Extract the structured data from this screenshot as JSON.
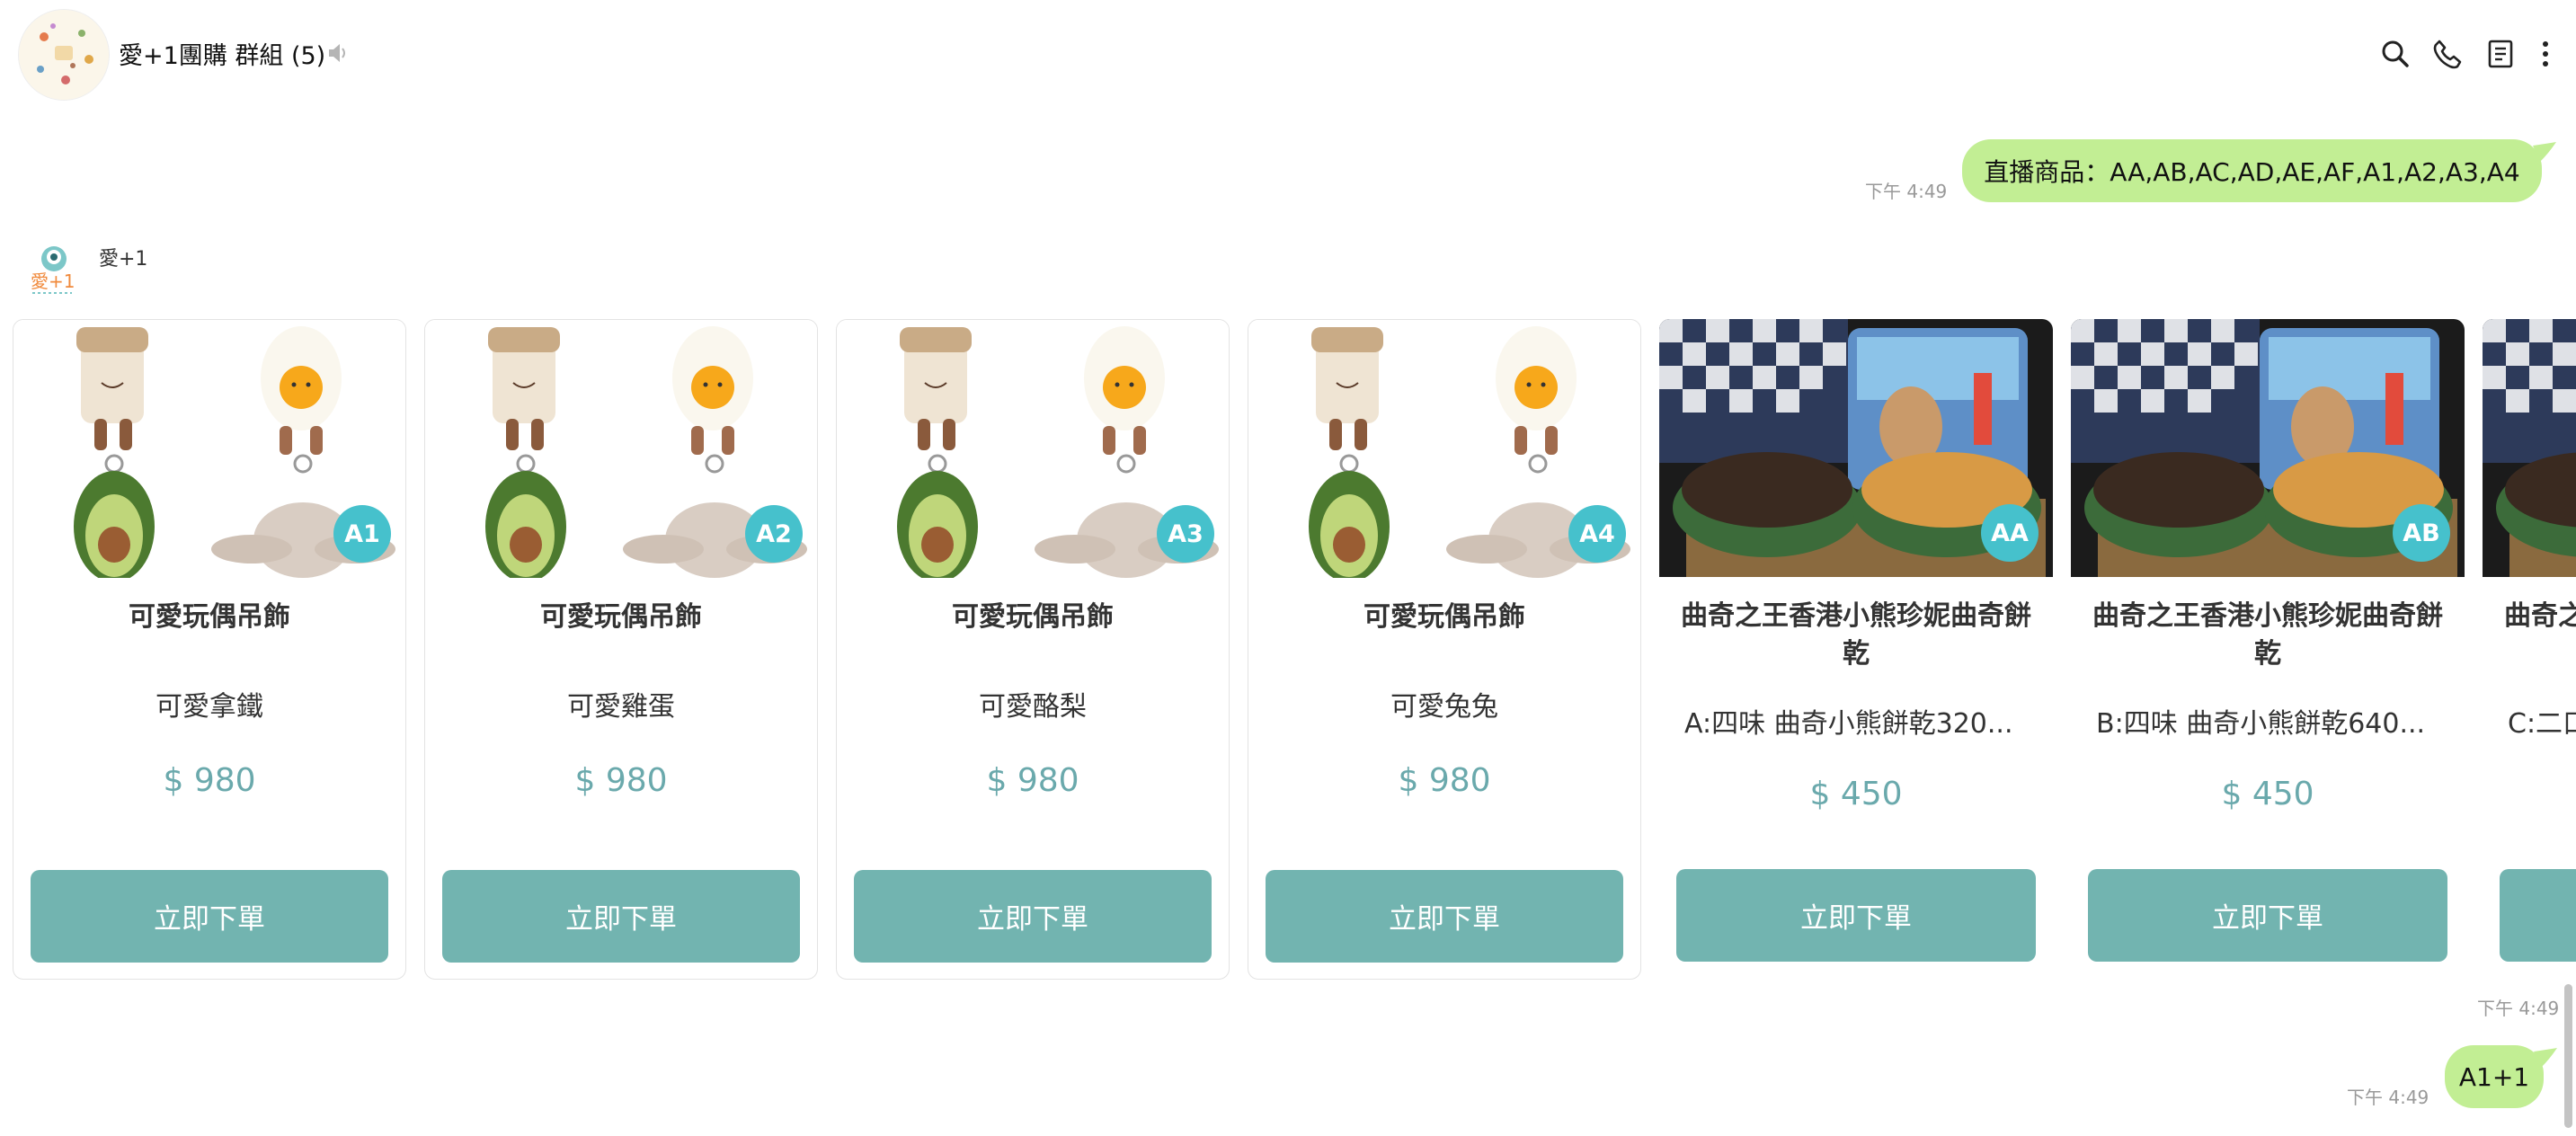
{
  "header": {
    "group_title": "愛+1團購 群組 (5)",
    "icons": [
      "search-icon",
      "phone-icon",
      "notes-icon",
      "more-icon"
    ]
  },
  "messages": [
    {
      "type": "outgoing",
      "text": "直播商品：AA,AB,AC,AD,AE,AF,A1,A2,A3,A4",
      "time": "下午 4:49"
    },
    {
      "type": "incoming",
      "sender": "愛+1",
      "avatar_text": "愛+1"
    },
    {
      "type": "outgoing",
      "text": "A1+1",
      "time": "下午 4:49"
    }
  ],
  "carousel": {
    "time": "下午 4:49",
    "cards": [
      {
        "badge": "A1",
        "title": "可愛玩偶吊飾",
        "option": "可愛拿鐵",
        "price": "$ 980",
        "button": "立即下單",
        "image": "toys"
      },
      {
        "badge": "A2",
        "title": "可愛玩偶吊飾",
        "option": "可愛雞蛋",
        "price": "$ 980",
        "button": "立即下單",
        "image": "toys"
      },
      {
        "badge": "A3",
        "title": "可愛玩偶吊飾",
        "option": "可愛酪梨",
        "price": "$ 980",
        "button": "立即下單",
        "image": "toys"
      },
      {
        "badge": "A4",
        "title": "可愛玩偶吊飾",
        "option": "可愛兔兔",
        "price": "$ 980",
        "button": "立即下單",
        "image": "toys"
      },
      {
        "badge": "AA",
        "title": "曲奇之王香港小熊珍妮曲奇餅乾",
        "option": "A:四味 曲奇小熊餅乾320...",
        "price": "$ 450",
        "button": "立即下單",
        "image": "cookies"
      },
      {
        "badge": "AB",
        "title": "曲奇之王香港小熊珍妮曲奇餅乾",
        "option": "B:四味 曲奇小熊餅乾640...",
        "price": "$ 450",
        "button": "立即下單",
        "image": "cookies"
      },
      {
        "badge": "",
        "title": "曲奇之王香港小熊珍妮曲奇餅乾",
        "option": "C:二口",
        "price": "",
        "button": "",
        "image": "cookies"
      }
    ]
  },
  "colors": {
    "bubble": "#c2ee94",
    "badge": "#46c1cc",
    "button": "#72b4b0",
    "price": "#6aa9ac"
  }
}
